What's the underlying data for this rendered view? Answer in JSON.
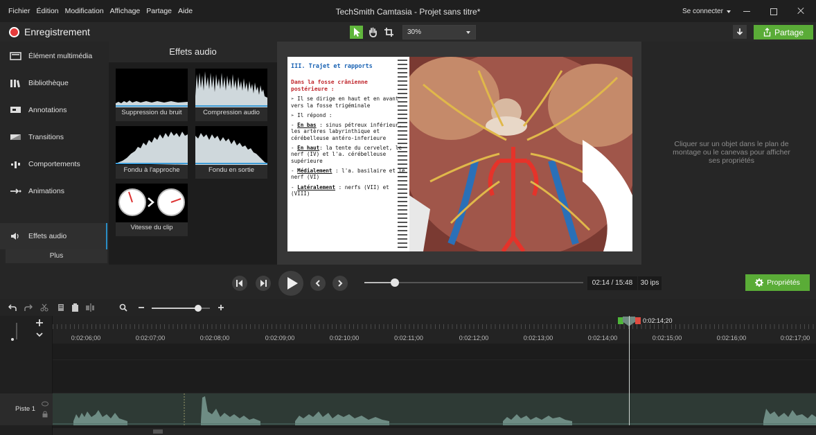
{
  "menu": [
    "Fichier",
    "Édition",
    "Modification",
    "Affichage",
    "Partage",
    "Aide"
  ],
  "window": {
    "title": "TechSmith Camtasia - Projet sans titre*",
    "connect_label": "Se connecter"
  },
  "toolbar": {
    "record_label": "Enregistrement",
    "zoom_value": "30%",
    "share_label": "Partage"
  },
  "sidebar": {
    "items": [
      {
        "label": "Élément multimédia",
        "icon": "media-icon"
      },
      {
        "label": "Bibliothèque",
        "icon": "library-icon"
      },
      {
        "label": "Annotations",
        "icon": "annotation-icon"
      },
      {
        "label": "Transitions",
        "icon": "transition-icon"
      },
      {
        "label": "Comportements",
        "icon": "behavior-icon"
      },
      {
        "label": "Animations",
        "icon": "animation-icon"
      },
      {
        "label": "Effets audio",
        "icon": "speaker-icon",
        "active": true
      }
    ],
    "more_label": "Plus"
  },
  "audio_panel": {
    "title": "Effets audio",
    "effects": [
      {
        "label": "Suppression du bruit"
      },
      {
        "label": "Compression audio"
      },
      {
        "label": "Fondu à l'approche"
      },
      {
        "label": "Fondu en sortie"
      },
      {
        "label": "Vitesse du clip"
      }
    ]
  },
  "slide": {
    "heading": "III.   Trajet et rapports",
    "subheading": "Dans la fosse crânienne postérieure :",
    "bullet1": "➢  Il se dirige en haut et en avant vers la fosse trigéminale",
    "bullet2": "➢  Il répond :",
    "p_bas_key": "En bas",
    "p_bas": " : sinus pétreux inférieur, les artères labyrinthique et cérébelleuse antéro-inferieure",
    "p_haut_key": "En haut",
    "p_haut": ": la tente du cervelet, le nerf (IV) et l'a. cérébelleuse supérieure",
    "p_med_key": "Médialement",
    "p_med": " : l'a. basilaire et le nerf (VI)",
    "p_lat_key": "Latéralement",
    "p_lat": " : nerfs (VII) et (VIII)"
  },
  "properties_hint": "Cliquer sur un objet dans le plan de montage ou le canevas pour afficher ses propriétés",
  "playback": {
    "time": "02:14 / 15:48",
    "fps": "30 ips",
    "progress": 0.14,
    "properties_label": "Propriétés"
  },
  "timeline": {
    "playhead_time": "0:02:14;20",
    "ticks": [
      "0:02:06;00",
      "0:02:07;00",
      "0:02:08;00",
      "0:02:09;00",
      "0:02:10;00",
      "0:02:11;00",
      "0:02:12;00",
      "0:02:13;00",
      "0:02:14;00",
      "0:02:15;00",
      "0:02:16;00",
      "0:02:17;00"
    ],
    "track_label": "Piste 1"
  },
  "colors": {
    "accent_green": "#5aac37",
    "record_red": "#e53b3b",
    "active_blue": "#2a8ec6"
  }
}
